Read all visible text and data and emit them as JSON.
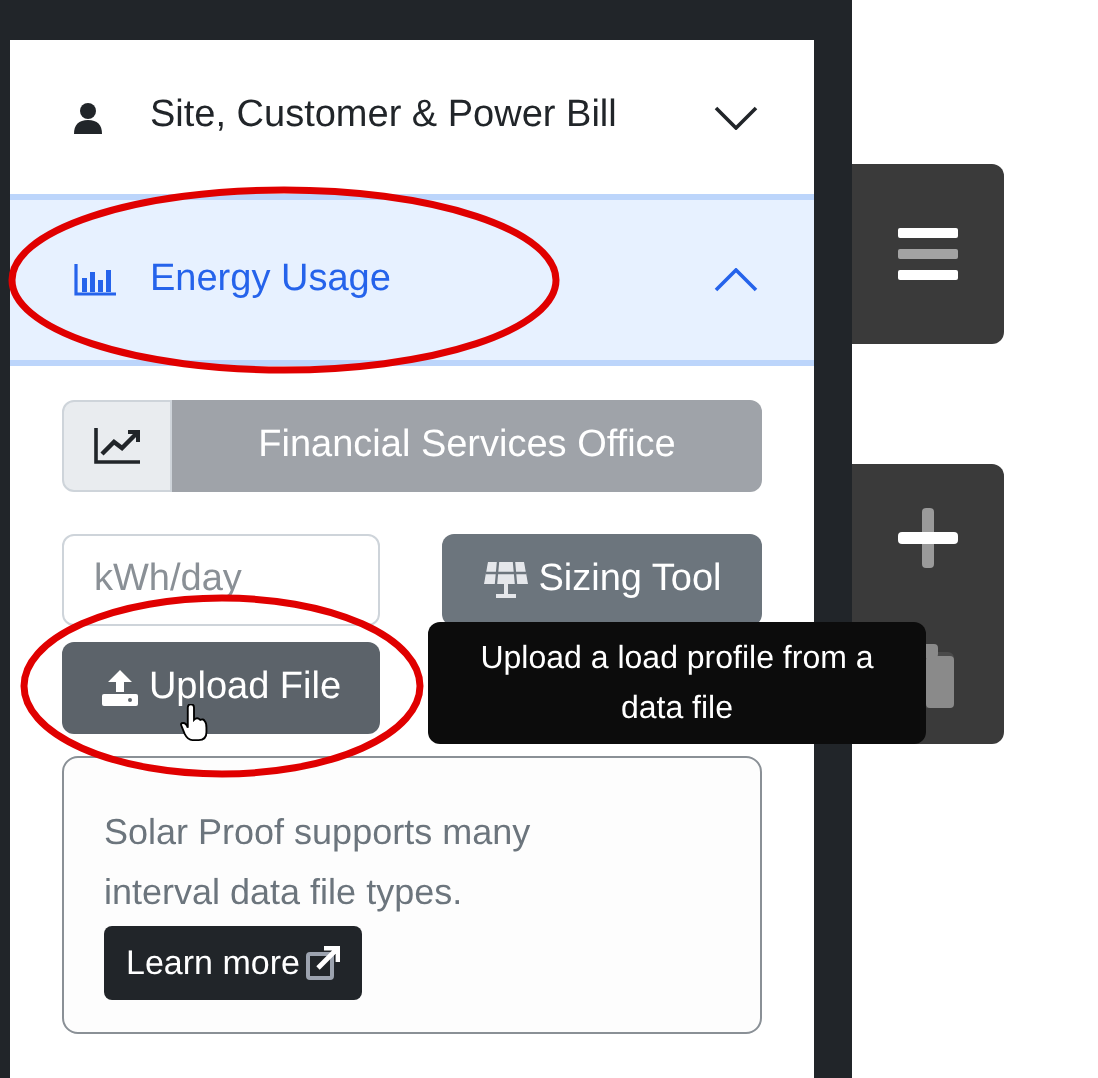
{
  "accordion": [
    {
      "title": "Site, Customer & Power Bill",
      "kind": "person",
      "expanded": false
    },
    {
      "title": "Energy Usage",
      "kind": "chart",
      "expanded": true
    }
  ],
  "profile_select": {
    "value": "Financial Services Office",
    "disabled": true
  },
  "usage_input": {
    "placeholder": "kWh/day"
  },
  "sizing_button": {
    "label": "Sizing Tool"
  },
  "upload_button": {
    "label": "Upload File",
    "hovered": true
  },
  "tooltip": {
    "text": "Upload a load profile from a data file"
  },
  "info": {
    "text": "Solar Proof supports many interval data file types.",
    "link": "Learn more"
  }
}
